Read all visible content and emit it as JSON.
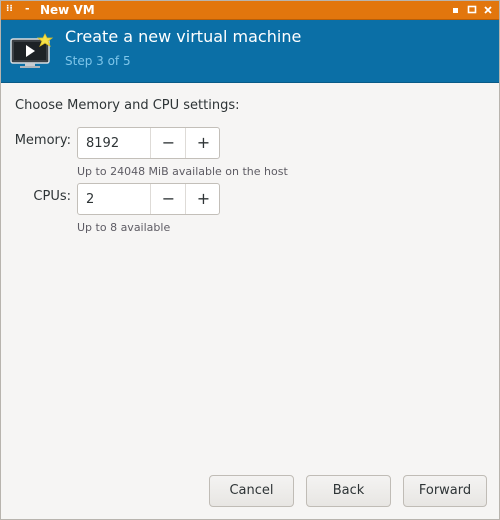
{
  "window": {
    "title": "New VM",
    "menu_icon": "window-menu-icon",
    "minimize_icon": "minimize-icon",
    "controls": [
      {
        "name": "minimize-button",
        "glyph": "▪"
      },
      {
        "name": "maximize-button",
        "glyph": "□"
      },
      {
        "name": "close-button",
        "glyph": "✕"
      }
    ]
  },
  "banner": {
    "icon": "virtual-machine-new-icon",
    "title": "Create a new virtual machine",
    "step": "Step 3 of 5",
    "colors": {
      "background": "#0b6fa6",
      "step_text": "#7fc6ea"
    }
  },
  "content": {
    "heading": "Choose Memory and CPU settings:",
    "memory": {
      "label": "Memory:",
      "value": "8192",
      "decrement": "−",
      "increment": "+",
      "hint": "Up to 24048 MiB available on the host"
    },
    "cpus": {
      "label": "CPUs:",
      "value": "2",
      "decrement": "−",
      "increment": "+",
      "hint": "Up to 8 available"
    }
  },
  "buttons": {
    "cancel": "Cancel",
    "back": "Back",
    "forward": "Forward"
  },
  "colors": {
    "titlebar": "#e2760d",
    "background": "#f6f5f4"
  }
}
